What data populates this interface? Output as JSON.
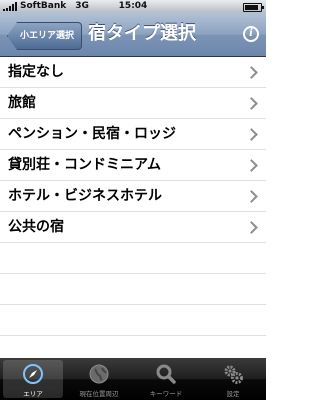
{
  "status_bar": {
    "carrier": "SoftBank",
    "network": "3G",
    "time": "15:04"
  },
  "nav": {
    "back_label": "小エリア選択",
    "title": "宿タイプ選択"
  },
  "list": {
    "items": [
      {
        "label": "指定なし"
      },
      {
        "label": "旅館"
      },
      {
        "label": "ペンション・民宿・ロッジ"
      },
      {
        "label": "貸別荘・コンドミニアム"
      },
      {
        "label": "ホテル・ビジネスホテル"
      },
      {
        "label": "公共の宿"
      }
    ]
  },
  "tabbar": {
    "tabs": [
      {
        "label": "エリア",
        "icon": "compass-icon"
      },
      {
        "label": "現在位置周辺",
        "icon": "globe-icon"
      },
      {
        "label": "キーワード",
        "icon": "search-icon"
      },
      {
        "label": "設定",
        "icon": "gear-icon"
      }
    ],
    "active": "エリア"
  }
}
